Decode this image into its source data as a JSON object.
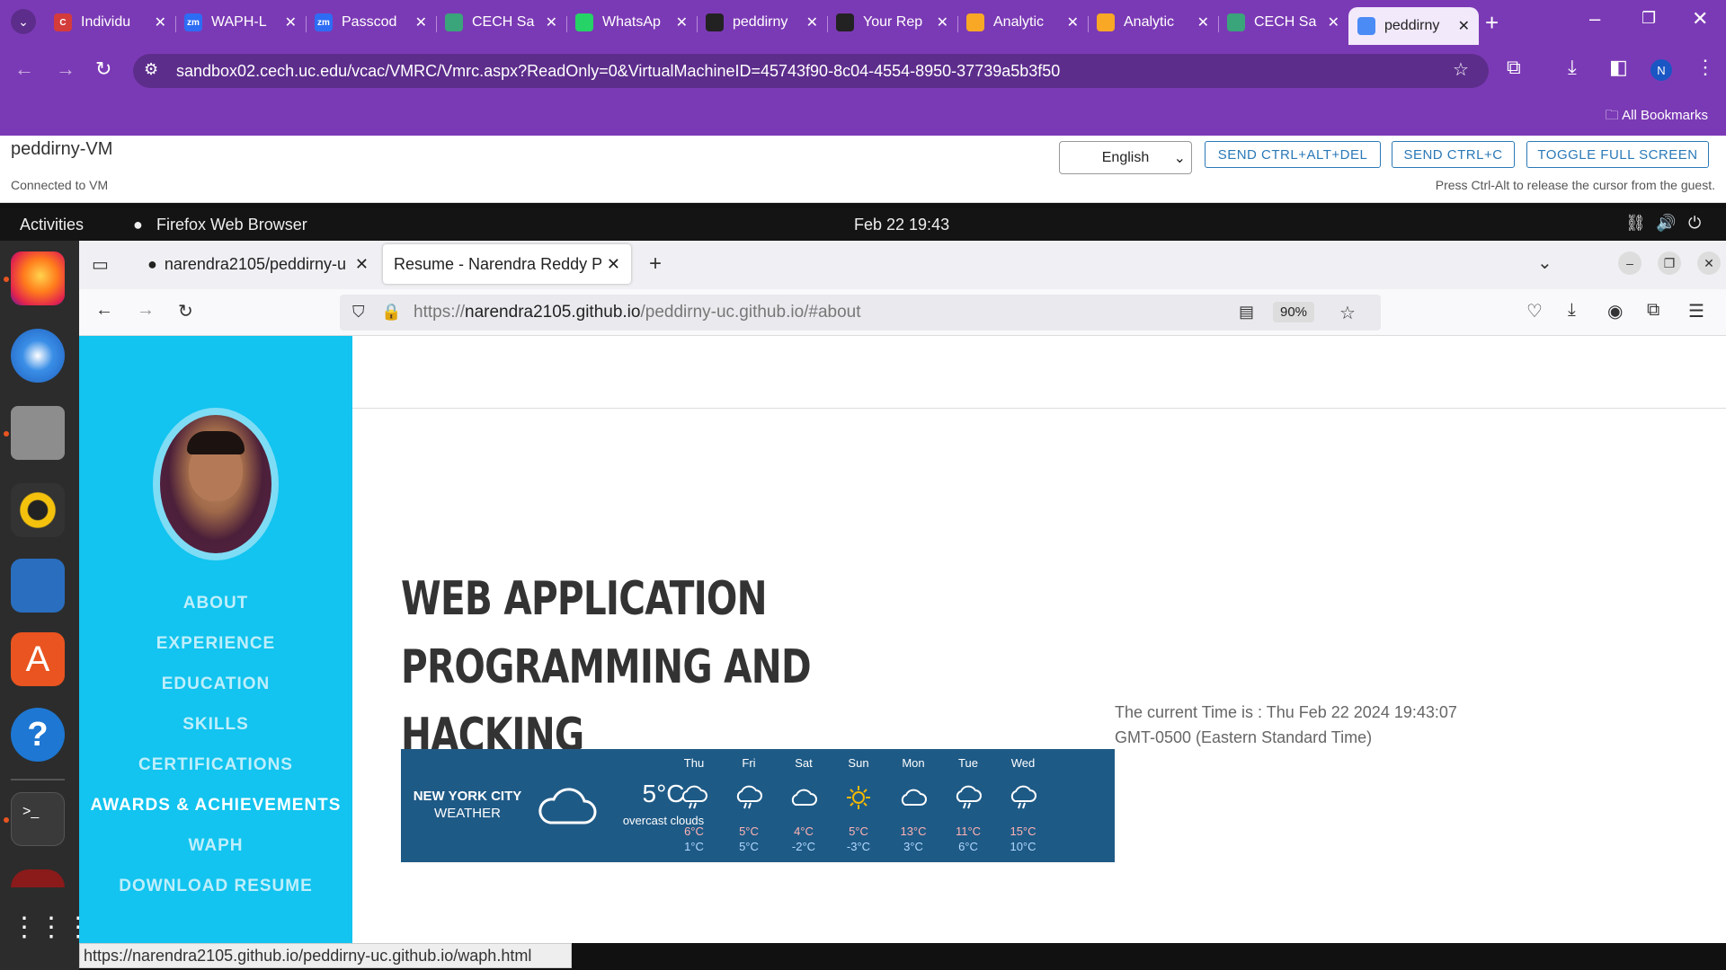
{
  "chrome": {
    "tabs": [
      {
        "label": "Individu",
        "fav": "C"
      },
      {
        "label": "WAPH-L",
        "fav": "zm"
      },
      {
        "label": "Passcod",
        "fav": "zm"
      },
      {
        "label": "CECH Sa",
        "fav": ""
      },
      {
        "label": "WhatsAp",
        "fav": ""
      },
      {
        "label": "peddirny",
        "fav": ""
      },
      {
        "label": "Your Rep",
        "fav": ""
      },
      {
        "label": "Analytic",
        "fav": ""
      },
      {
        "label": "Analytic",
        "fav": ""
      },
      {
        "label": "CECH Sa",
        "fav": ""
      },
      {
        "label": "peddirny",
        "fav": ""
      }
    ],
    "url": "sandbox02.cech.uc.edu/vcac/VMRC/Vmrc.aspx?ReadOnly=0&VirtualMachineID=45743f90-8c04-4554-8950-37739a5b3f50",
    "bookmarks_label": "All Bookmarks",
    "profile_initial": "N"
  },
  "vmrc": {
    "title": "peddirny-VM",
    "status": "Connected to VM",
    "language": "English",
    "btn_ctrl_alt_del": "SEND CTRL+ALT+DEL",
    "btn_ctrl_c": "SEND CTRL+C",
    "btn_fullscreen": "TOGGLE FULL SCREEN",
    "hint": "Press Ctrl-Alt to release the cursor from the guest."
  },
  "gnome": {
    "activities": "Activities",
    "app": "Firefox Web Browser",
    "clock": "Feb 22  19:43"
  },
  "firefox": {
    "tab1": "narendra2105/peddirny-u",
    "tab2": "Resume - Narendra Reddy Pe",
    "url_prefix": "https://",
    "url_domain": "narendra2105.github.io",
    "url_path": "/peddirny-uc.github.io/#about",
    "zoom": "90%",
    "status_url": "https://narendra2105.github.io/peddirny-uc.github.io/waph.html"
  },
  "page": {
    "nav": [
      "ABOUT",
      "EXPERIENCE",
      "EDUCATION",
      "SKILLS",
      "CERTIFICATIONS",
      "AWARDS & ACHIEVEMENTS",
      "WAPH",
      "DOWNLOAD RESUME"
    ],
    "heading_line1": "WEB APPLICATION PROGRAMMING AND",
    "heading_line2": "HACKING",
    "time_text": "The current Time is : Thu Feb 22 2024 19:43:07 GMT-0500 (Eastern Standard Time)",
    "weather": {
      "city": "NEW YORK CITY",
      "label": "WEATHER",
      "temp": "5°C",
      "desc": "overcast clouds",
      "days": [
        {
          "d": "Thu",
          "hi": "6°C",
          "lo": "1°C",
          "icon": "rain"
        },
        {
          "d": "Fri",
          "hi": "5°C",
          "lo": "5°C",
          "icon": "rain"
        },
        {
          "d": "Sat",
          "hi": "4°C",
          "lo": "-2°C",
          "icon": "cloud"
        },
        {
          "d": "Sun",
          "hi": "5°C",
          "lo": "-3°C",
          "icon": "sun"
        },
        {
          "d": "Mon",
          "hi": "13°C",
          "lo": "3°C",
          "icon": "cloud"
        },
        {
          "d": "Tue",
          "hi": "11°C",
          "lo": "6°C",
          "icon": "rain"
        },
        {
          "d": "Wed",
          "hi": "15°C",
          "lo": "10°C",
          "icon": "rain"
        }
      ]
    }
  }
}
